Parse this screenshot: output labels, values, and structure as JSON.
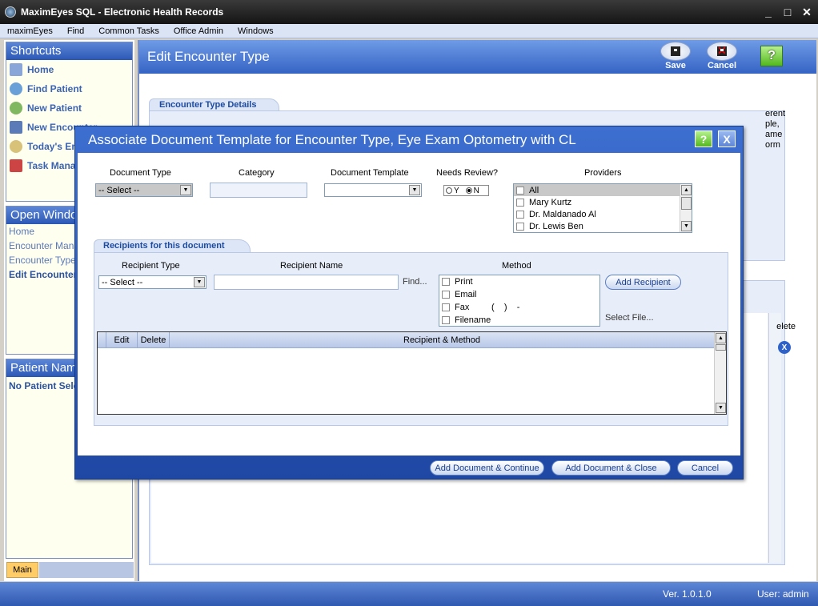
{
  "window": {
    "title": "MaximEyes SQL - Electronic Health Records",
    "controls": [
      "_",
      "□",
      "✕"
    ]
  },
  "menu": [
    "maximEyes",
    "Find",
    "Common Tasks",
    "Office Admin",
    "Windows"
  ],
  "sidebar": {
    "shortcuts_title": "Shortcuts",
    "shortcuts": [
      "Home",
      "Find Patient",
      "New Patient",
      "New Encounter",
      "Today's Encounters",
      "Task Manager"
    ],
    "open_windows_title": "Open Windows",
    "open_windows": [
      "Home",
      "Encounter Manager",
      "Encounter Types",
      "Edit Encounter Type"
    ],
    "patient_title": "Patient Name",
    "patient_value": "No Patient Selected",
    "main_tab": "Main"
  },
  "main": {
    "title": "Edit Encounter Type",
    "save_label": "Save",
    "cancel_label": "Cancel",
    "help_label": "?",
    "details_tab": "Encounter Type Details",
    "details_text": "erent\nple,\name\norm",
    "lower_delete": "elete",
    "lower_x": "X"
  },
  "dialog": {
    "title": "Associate Document Template for Encounter Type, Eye Exam Optometry with CL",
    "help_label": "?",
    "close_label": "X",
    "labels": {
      "document_type": "Document Type",
      "category": "Category",
      "document_template": "Document Template",
      "needs_review": "Needs Review?",
      "providers": "Providers"
    },
    "document_type_value": "-- Select --",
    "needs_review": {
      "y": "Y",
      "n": "N",
      "selected": "N"
    },
    "providers": [
      "All",
      "Mary Kurtz",
      "Dr. Maldanado Al",
      "Dr. Lewis Ben"
    ],
    "recipients": {
      "tab": "Recipients for this document",
      "recipient_type_label": "Recipient Type",
      "recipient_type_value": "-- Select --",
      "recipient_name_label": "Recipient Name",
      "find_label": "Find...",
      "method_label": "Method",
      "methods": [
        "Print",
        "Email",
        "Fax",
        "Filename"
      ],
      "fax_mask": "(    )    -",
      "add_recipient": "Add Recipient",
      "select_file": "Select File...",
      "grid_headers": [
        "Edit",
        "Delete",
        "Recipient & Method"
      ]
    },
    "buttons": {
      "add_continue": "Add Document & Continue",
      "add_close": "Add Document & Close",
      "cancel": "Cancel"
    }
  },
  "status": {
    "version": "Ver. 1.0.1.0",
    "user": "User: admin"
  },
  "colors": {
    "accent": "#3563c4",
    "titlebar": "#141414",
    "panel_bg": "#fffff0"
  }
}
